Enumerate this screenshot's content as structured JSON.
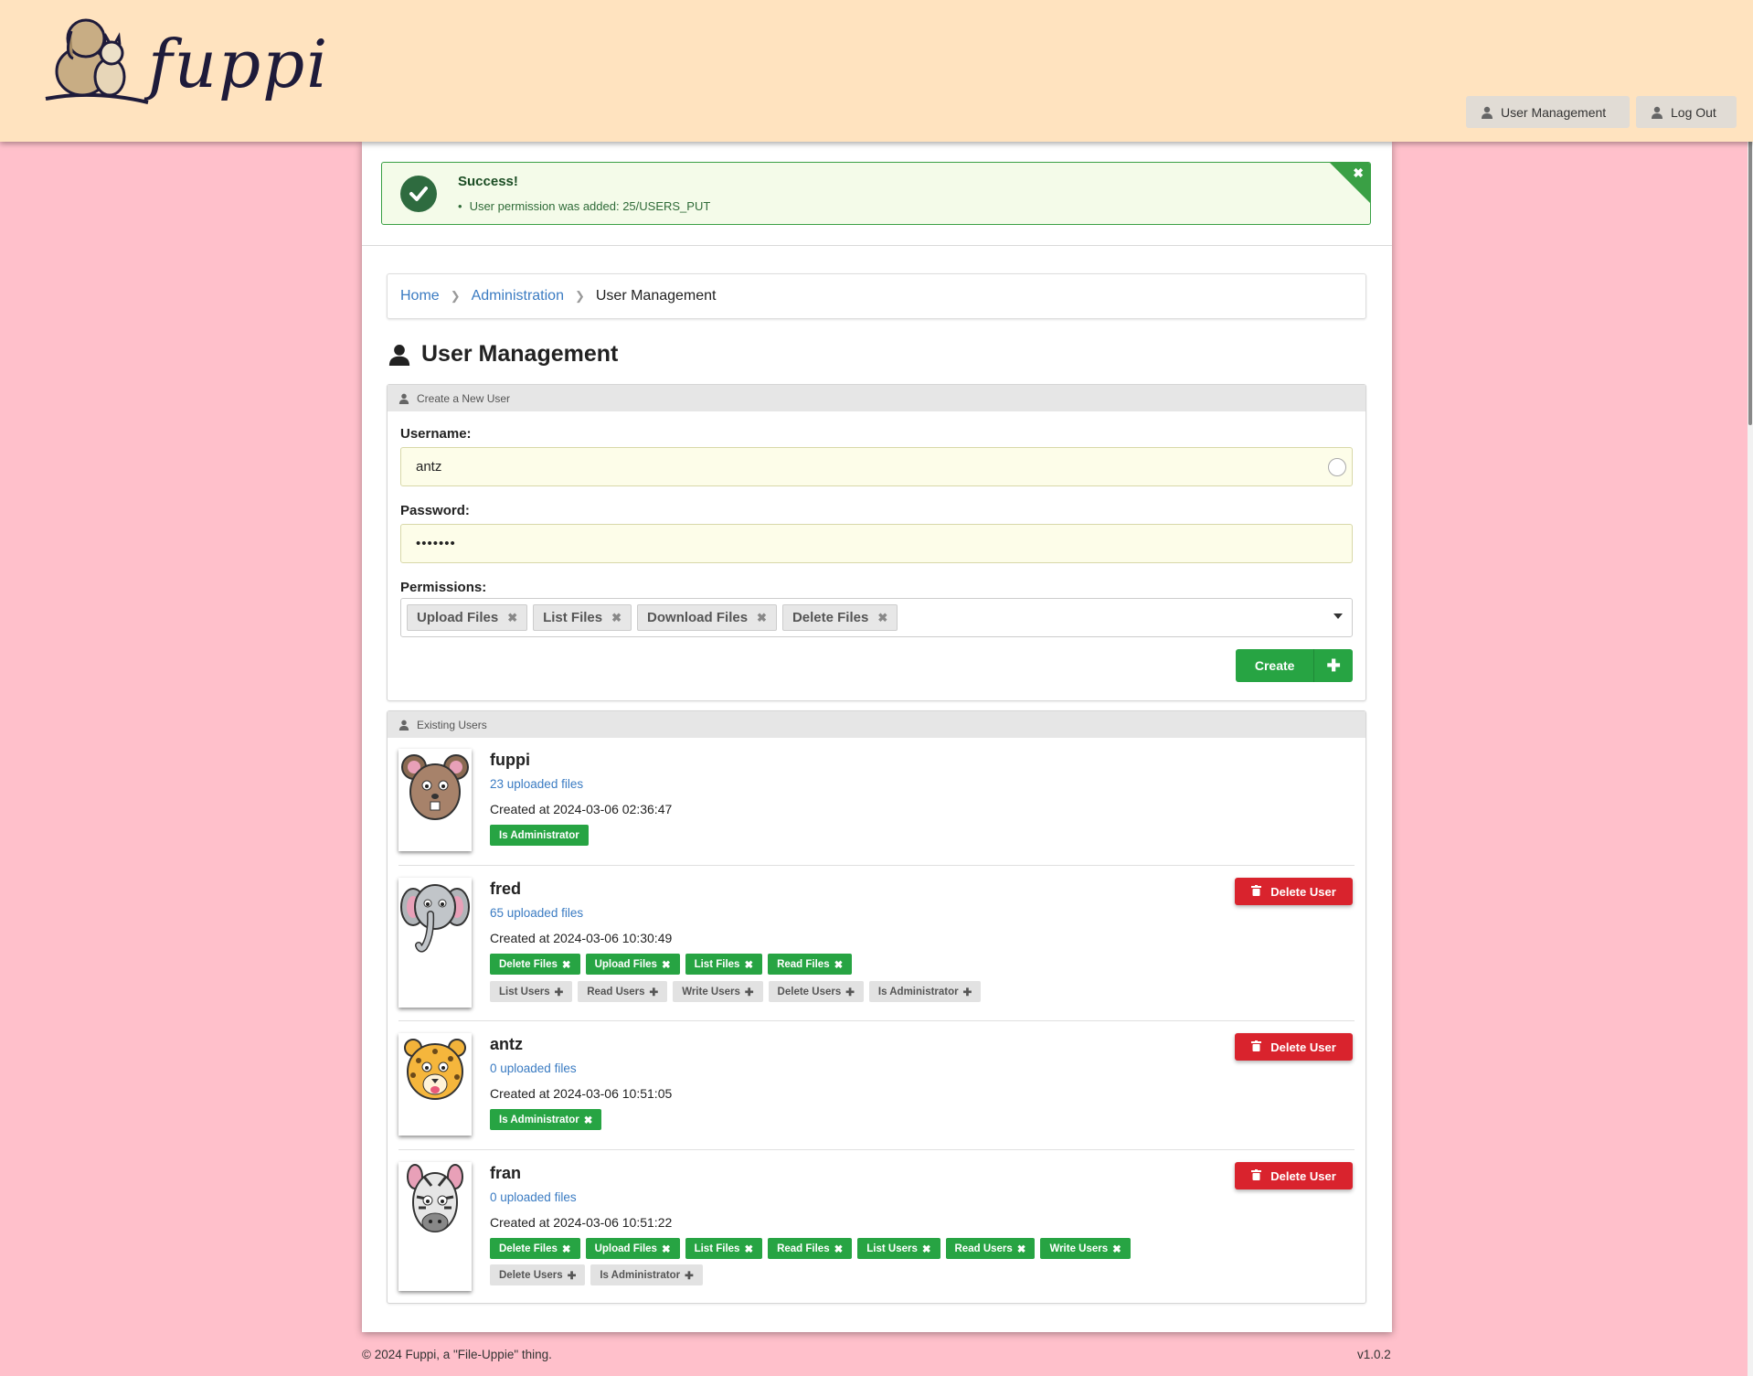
{
  "header": {
    "logo_text": "fuppi",
    "nav": {
      "user_management": "User Management",
      "log_out": "Log Out"
    }
  },
  "alert": {
    "title": "Success!",
    "message": "User permission was added: 25/USERS_PUT"
  },
  "breadcrumb": {
    "home": "Home",
    "admin": "Administration",
    "current": "User Management"
  },
  "page_title": "User Management",
  "create_form": {
    "header": "Create a New User",
    "username_label": "Username:",
    "username_value": "antz",
    "password_label": "Password:",
    "password_value": "•••••••",
    "permissions_label": "Permissions:",
    "permissions_selected": [
      "Upload Files",
      "List Files",
      "Download Files",
      "Delete Files"
    ],
    "create_label": "Create"
  },
  "users_section": {
    "header": "Existing Users",
    "delete_label": "Delete User",
    "users": [
      {
        "name": "fuppi",
        "files": "23 uploaded files",
        "created": "Created at 2024-03-06 02:36:47",
        "avatar": "mouse-avatar",
        "granted": [
          "Is Administrator"
        ],
        "available": []
      },
      {
        "name": "fred",
        "files": "65 uploaded files",
        "created": "Created at 2024-03-06 10:30:49",
        "avatar": "elephant-avatar",
        "granted": [
          "Delete Files",
          "Upload Files",
          "List Files",
          "Read Files"
        ],
        "available": [
          "List Users",
          "Read Users",
          "Write Users",
          "Delete Users",
          "Is Administrator"
        ]
      },
      {
        "name": "antz",
        "files": "0 uploaded files",
        "created": "Created at 2024-03-06 10:51:05",
        "avatar": "cheetah-avatar",
        "granted": [
          "Is Administrator"
        ],
        "available": []
      },
      {
        "name": "fran",
        "files": "0 uploaded files",
        "created": "Created at 2024-03-06 10:51:22",
        "avatar": "zebra-avatar",
        "granted": [
          "Delete Files",
          "Upload Files",
          "List Files",
          "Read Files",
          "List Users",
          "Read Users",
          "Write Users"
        ],
        "available": [
          "Delete Users",
          "Is Administrator"
        ]
      }
    ]
  },
  "footer": {
    "copyright": "© 2024 Fuppi, a \"File-Uppie\" thing.",
    "version": "v1.0.2"
  },
  "colors": {
    "header_bg": "#ffe3bf",
    "page_bg": "#ffc0cb",
    "success": "#27a443",
    "danger": "#d9232d",
    "link": "#3a7bc2"
  }
}
